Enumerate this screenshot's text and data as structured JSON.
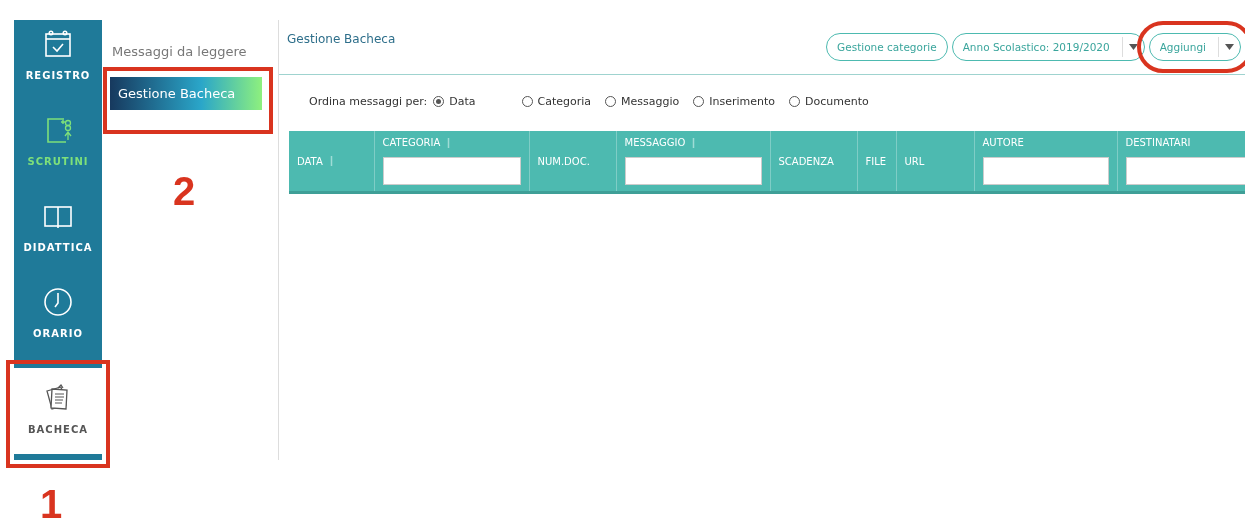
{
  "sidebar": {
    "items": [
      {
        "label": "REGISTRO",
        "selected": false,
        "highlighted": false,
        "annotated": false
      },
      {
        "label": "SCRUTINI",
        "selected": false,
        "highlighted": true,
        "annotated": false
      },
      {
        "label": "DIDATTICA",
        "selected": false,
        "highlighted": false,
        "annotated": false
      },
      {
        "label": "ORARIO",
        "selected": false,
        "highlighted": false,
        "annotated": false
      },
      {
        "label": "BACHECA",
        "selected": true,
        "highlighted": false,
        "annotated": true
      }
    ]
  },
  "submenu": {
    "items": [
      {
        "label": "Messaggi da leggere",
        "selected": false,
        "annotated": false
      },
      {
        "label": "Gestione Bacheca",
        "selected": true,
        "annotated": true
      }
    ]
  },
  "header": {
    "title": "Gestione Bacheca",
    "buttons": [
      {
        "kind": "pill",
        "label": "Gestione categorie",
        "annotated": false
      },
      {
        "kind": "dropdown",
        "label": "Anno Scolastico: 2019/2020",
        "annotated": false
      },
      {
        "kind": "dropdown",
        "label": "Aggiungi",
        "annotated": true
      }
    ]
  },
  "sort": {
    "label": "Ordina messaggi per:",
    "options": [
      {
        "label": "Data",
        "selected": true
      },
      {
        "label": "Categoria",
        "selected": false
      },
      {
        "label": "Messaggio",
        "selected": false
      },
      {
        "label": "Inserimento",
        "selected": false
      },
      {
        "label": "Documento",
        "selected": false
      }
    ]
  },
  "table": {
    "columns": [
      {
        "label": "DATA",
        "sortable": true,
        "filter": false
      },
      {
        "label": "CATEGORIA",
        "sortable": true,
        "filter": true
      },
      {
        "label": "NUM.DOC.",
        "sortable": false,
        "filter": false
      },
      {
        "label": "MESSAGGIO",
        "sortable": true,
        "filter": true
      },
      {
        "label": "SCADENZA",
        "sortable": false,
        "filter": false
      },
      {
        "label": "FILE",
        "sortable": false,
        "filter": false
      },
      {
        "label": "URL",
        "sortable": false,
        "filter": false
      },
      {
        "label": "AUTORE",
        "sortable": false,
        "filter": true
      },
      {
        "label": "DESTINATARI",
        "sortable": false,
        "filter": true
      }
    ]
  },
  "annotations": [
    {
      "label": "1"
    },
    {
      "label": "2"
    }
  ]
}
